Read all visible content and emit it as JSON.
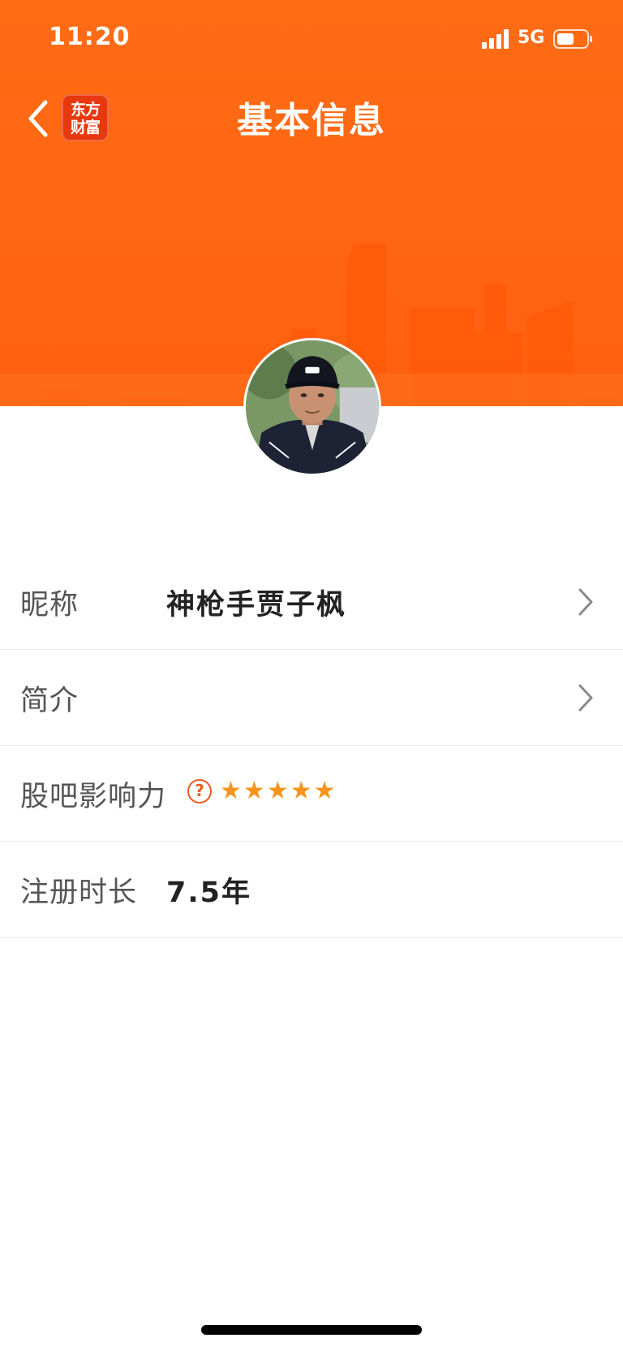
{
  "status_bar": {
    "time": "11:20",
    "network": "5G",
    "icons": [
      "signal-icon",
      "battery-icon"
    ]
  },
  "nav": {
    "back_icon": "chevron-left-icon",
    "app_logo": {
      "line1": "东方",
      "line2": "财富"
    },
    "title": "基本信息"
  },
  "profile": {
    "avatar": "avatar-photo"
  },
  "rows": {
    "nickname": {
      "label": "昵称",
      "value": "神枪手贾子枫"
    },
    "bio": {
      "label": "简介",
      "value": ""
    },
    "influence": {
      "label": "股吧影响力",
      "help_icon": "question-icon",
      "stars_filled": 5,
      "stars_total": 5,
      "star_char": "★"
    },
    "registration": {
      "label": "注册时长",
      "value": "7.5年"
    }
  },
  "colors": {
    "header": "#ff6612",
    "accent": "#e95a1c",
    "star": "#f7941d",
    "label": "#555555",
    "value": "#222222"
  }
}
